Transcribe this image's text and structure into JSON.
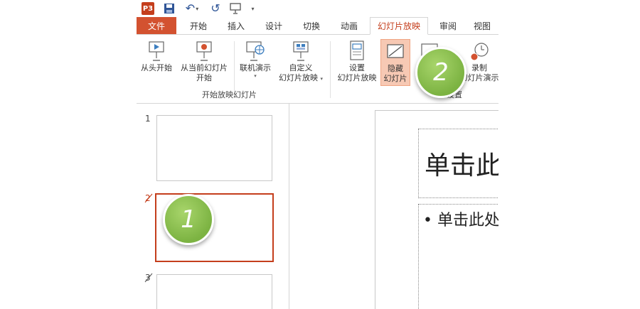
{
  "qat": {
    "app_icon_letter": "P3",
    "save_icon": "💾",
    "undo_icon": "↶",
    "redo_icon": "↺",
    "present_icon": "⊚",
    "more_icon": "▾"
  },
  "tabs": [
    {
      "label": "文件",
      "state": "file"
    },
    {
      "label": "开始"
    },
    {
      "label": "插入"
    },
    {
      "label": "设计"
    },
    {
      "label": "切换"
    },
    {
      "label": "动画"
    },
    {
      "label": "幻灯片放映",
      "state": "active"
    },
    {
      "label": "审阅"
    },
    {
      "label": "视图"
    }
  ],
  "ribbon": {
    "from_beginning": "从头开始",
    "from_current_line1": "从当前幻灯片",
    "from_current_line2": "开始",
    "present_online": "联机演示",
    "custom_show_line1": "自定义",
    "custom_show_line2": "幻灯片放映",
    "start_group_label": "开始放映幻灯片",
    "setup_line1": "设置",
    "setup_line2": "幻灯片放映",
    "hide_line1": "隐藏",
    "hide_line2": "幻灯片",
    "record_line1": "录制",
    "record_line2": "幻灯片演示",
    "setup_group_label": "设置"
  },
  "thumbnails": [
    {
      "number": "1"
    },
    {
      "number": "2"
    },
    {
      "number": "3"
    }
  ],
  "slide": {
    "title_text": "单击此",
    "body_text": "• 单击此处"
  },
  "callouts": {
    "one": "1",
    "two": "2"
  },
  "colors": {
    "accent": "#c43e1c",
    "callout": "#7cb342"
  }
}
